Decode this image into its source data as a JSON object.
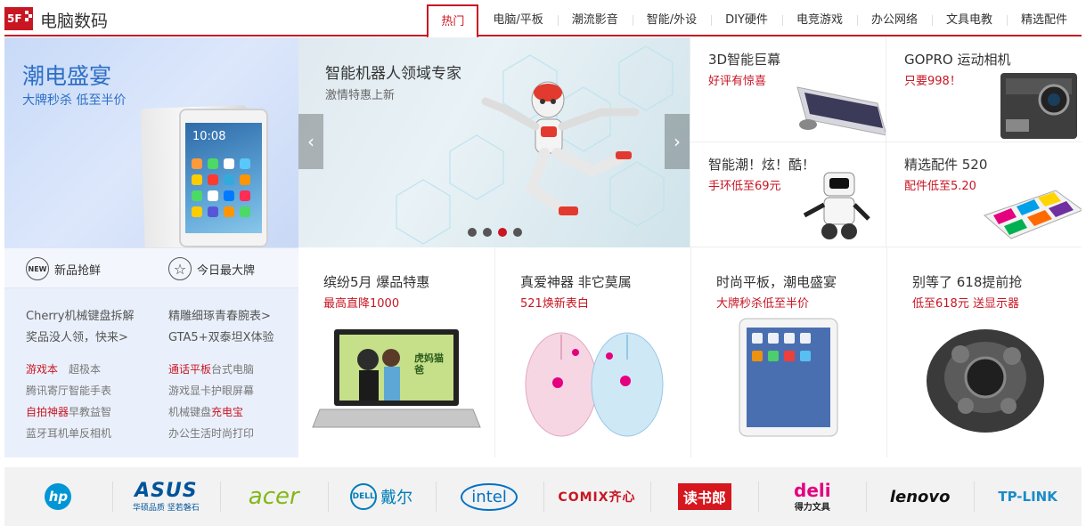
{
  "header": {
    "floor_badge": "5F",
    "title": "电脑数码",
    "tabs": [
      {
        "label": "热门",
        "active": true
      },
      {
        "label": "电脑/平板"
      },
      {
        "label": "潮流影音"
      },
      {
        "label": "智能/外设"
      },
      {
        "label": "DIY硬件"
      },
      {
        "label": "电竞游戏"
      },
      {
        "label": "办公网络"
      },
      {
        "label": "文具电教"
      },
      {
        "label": "精选配件"
      }
    ]
  },
  "left": {
    "banner_title": "潮电盛宴",
    "banner_subtitle": "大牌秒杀 低至半价",
    "tablet_clock": "10:08",
    "promos": [
      {
        "icon": "new-icon",
        "badge": "NEW",
        "label": "新品抢鲜"
      },
      {
        "icon": "star-icon",
        "badge": "☆",
        "label": "今日最大牌"
      }
    ],
    "news_left": [
      "Cherry机械键盘拆解",
      "奖品没人领，快来>"
    ],
    "news_right": [
      "精雕细琢青春腕表>",
      "GTA5+双泰坦X体验"
    ],
    "keywords_left": [
      {
        "text": "游戏本",
        "hot": true
      },
      {
        "text": "超极本"
      },
      {
        "text": "腾讯寄厅"
      },
      {
        "text": "智能手表"
      },
      {
        "text": "自拍神器",
        "hot": true
      },
      {
        "text": "早教益智"
      },
      {
        "text": "蓝牙耳机"
      },
      {
        "text": "单反相机"
      }
    ],
    "keywords_right": [
      {
        "text": "通话平板",
        "hot": true
      },
      {
        "text": "台式电脑"
      },
      {
        "text": "游戏显卡"
      },
      {
        "text": "护眼屏幕"
      },
      {
        "text": "机械键盘"
      },
      {
        "text": "充电宝",
        "hot": true
      },
      {
        "text": "办公生活"
      },
      {
        "text": "时尚打印"
      }
    ]
  },
  "carousel": {
    "title": "智能机器人领域专家",
    "subtitle": "激情特惠上新",
    "prev": "‹",
    "next": "›",
    "active_dot": 2
  },
  "tiles": [
    {
      "title": "3D智能巨幕",
      "sub": "好评有惊喜"
    },
    {
      "title": "GOPRO 运动相机",
      "sub": "只要998！"
    },
    {
      "title": "智能潮！炫！酷！",
      "sub": "手环低至69元"
    },
    {
      "title": "精选配件 520",
      "sub": "配件低至5.20"
    }
  ],
  "products": [
    {
      "title": "缤纷5月 爆品特惠",
      "sub": "最高直降1000",
      "screen_text": "虎妈猫爸"
    },
    {
      "title": "真爱神器 非它莫属",
      "sub": "521焕新表白"
    },
    {
      "title": "时尚平板，潮电盛宴",
      "sub": "大牌秒杀低至半价"
    },
    {
      "title": "别等了 618提前抢",
      "sub": "低至618元 送显示器"
    }
  ],
  "brands": [
    {
      "name": "hp",
      "color": "#0096d6"
    },
    {
      "name": "ASUS",
      "sub": "华硕品质 坚若磐石",
      "color": "#00539b"
    },
    {
      "name": "acer",
      "color": "#83b81a"
    },
    {
      "name": "DELL",
      "sub": "戴尔",
      "color": "#007db8"
    },
    {
      "name": "intel",
      "color": "#0071c5"
    },
    {
      "name": "COMIX齐心",
      "color": "#c81623"
    },
    {
      "name": "读书郎",
      "color": "#d6171e"
    },
    {
      "name": "deli",
      "sub": "得力文具",
      "color": "#e4007f"
    },
    {
      "name": "lenovo",
      "color": "#111111"
    },
    {
      "name": "TP-LINK",
      "color": "#1a8cc9"
    }
  ]
}
